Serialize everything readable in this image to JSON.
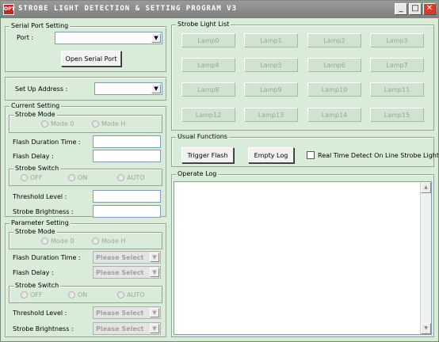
{
  "window": {
    "title": "STROBE LIGHT DETECTION & SETTING PROGRAM V3",
    "app_icon": "OPT",
    "icon": "window-app-icon",
    "minimize": "_",
    "maximize": "□",
    "close": "✕"
  },
  "serial_port": {
    "legend": "Serial Port Setting",
    "port_label": "Port :",
    "port_value": "",
    "open_button": "Open Serial Port"
  },
  "setup_address": {
    "label": "Set Up Address :",
    "value": ""
  },
  "current_setting": {
    "legend": "Current Setting",
    "strobe_mode_legend": "Strobe Mode",
    "mode_0": "Mode 0",
    "mode_h": "Mode H",
    "flash_duration_label": "Flash Duration Time :",
    "flash_delay_label": "Flash Delay :",
    "strobe_switch_legend": "Strobe Switch",
    "off": "OFF",
    "on": "ON",
    "auto": "AUTO",
    "threshold_label": "Threshold Level :",
    "brightness_label": "Strobe Brightness :"
  },
  "parameter_setting": {
    "legend": "Parameter Setting",
    "strobe_mode_legend": "Strobe Mode",
    "mode_0": "Mode 0",
    "mode_h": "Mode H",
    "flash_duration_label": "Flash Duration Time :",
    "flash_delay_label": "Flash Delay :",
    "strobe_switch_legend": "Strobe Switch",
    "off": "OFF",
    "on": "ON",
    "auto": "AUTO",
    "threshold_label": "Threshold Level :",
    "brightness_label": "Strobe Brightness :",
    "placeholder": "Please Select"
  },
  "lamp_list": {
    "legend": "Strobe Light List",
    "lamps": [
      "Lamp0",
      "Lamp1",
      "Lamp2",
      "Lamp3",
      "Lamp4",
      "Lamp5",
      "Lamp6",
      "Lamp7",
      "Lamp8",
      "Lamp9",
      "Lamp10",
      "Lamp11",
      "Lamp12",
      "Lamp13",
      "Lamp14",
      "Lamp15"
    ]
  },
  "usual_functions": {
    "legend": "Usual Functions",
    "trigger_flash": "Trigger Flash",
    "empty_log": "Empty Log",
    "realtime_detect": "Real Time Detect On Line Strobe Light"
  },
  "operate_log": {
    "legend": "Operate Log",
    "up_arrow": "▲",
    "down_arrow": "▼"
  },
  "dropdown_arrow": "▼"
}
